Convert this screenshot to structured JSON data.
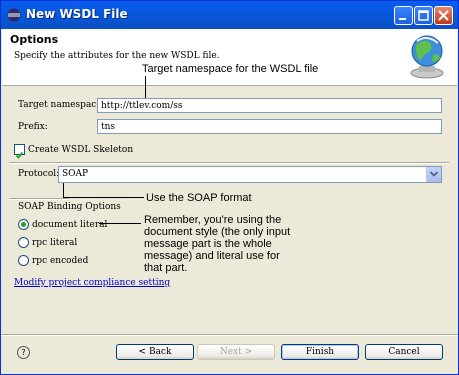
{
  "window": {
    "title": "New WSDL File"
  },
  "header": {
    "title": "Options",
    "description": "Specify the attributes for the new WSDL file."
  },
  "form": {
    "target_namespace": {
      "label": "Target namespace:",
      "value": "http://ttlev.com/ss"
    },
    "prefix": {
      "label": "Prefix:",
      "value": "tns"
    },
    "create_skeleton": {
      "label": "Create WSDL Skeleton",
      "checked": true
    },
    "protocol": {
      "label": "Protocol:",
      "value": "SOAP"
    },
    "soap_binding": {
      "label": "SOAP Binding Options",
      "options": [
        "document literal",
        "rpc literal",
        "rpc encoded"
      ],
      "selected": "document literal"
    },
    "compliance_link": "Modify project compliance setting"
  },
  "annotations": {
    "namespace": "Target namespace for the WSDL file",
    "soap": "Use the SOAP format",
    "binding": [
      "Remember, you're using the",
      "document style (the only input",
      "message part is the whole",
      "message) and literal use for",
      "that part."
    ]
  },
  "buttons": {
    "back": "< Back",
    "next": "Next >",
    "finish": "Finish",
    "cancel": "Cancel"
  },
  "help_icon": "?"
}
